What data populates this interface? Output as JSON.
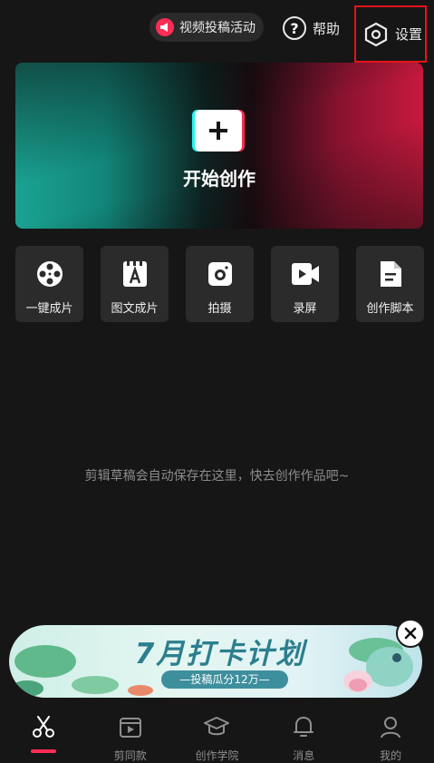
{
  "header": {
    "promo_label": "视频投稿活动",
    "help_label": "帮助",
    "settings_label": "设置"
  },
  "hero": {
    "label": "开始创作"
  },
  "tools": [
    {
      "label": "一键成片",
      "icon": "film-reel-icon"
    },
    {
      "label": "图文成片",
      "icon": "text-doc-icon"
    },
    {
      "label": "拍摄",
      "icon": "camera-icon"
    },
    {
      "label": "录屏",
      "icon": "screen-record-icon"
    },
    {
      "label": "创作脚本",
      "icon": "script-doc-icon"
    }
  ],
  "empty_hint": "剪辑草稿会自动保存在这里，快去创作作品吧~",
  "banner": {
    "title": "7月打卡计划",
    "subtitle": "—投稿瓜分12万—"
  },
  "bottom_nav": [
    {
      "label": "",
      "icon": "scissors-icon",
      "active": true
    },
    {
      "label": "剪同款",
      "icon": "template-play-icon"
    },
    {
      "label": "创作学院",
      "icon": "graduation-cap-icon"
    },
    {
      "label": "消息",
      "icon": "bell-icon"
    },
    {
      "label": "我的",
      "icon": "profile-icon"
    }
  ],
  "colors": {
    "accent": "#fe2c55",
    "teal": "#25f4ee",
    "background": "#161616",
    "card": "#2b2b2b",
    "highlight_box": "#e5141b"
  }
}
